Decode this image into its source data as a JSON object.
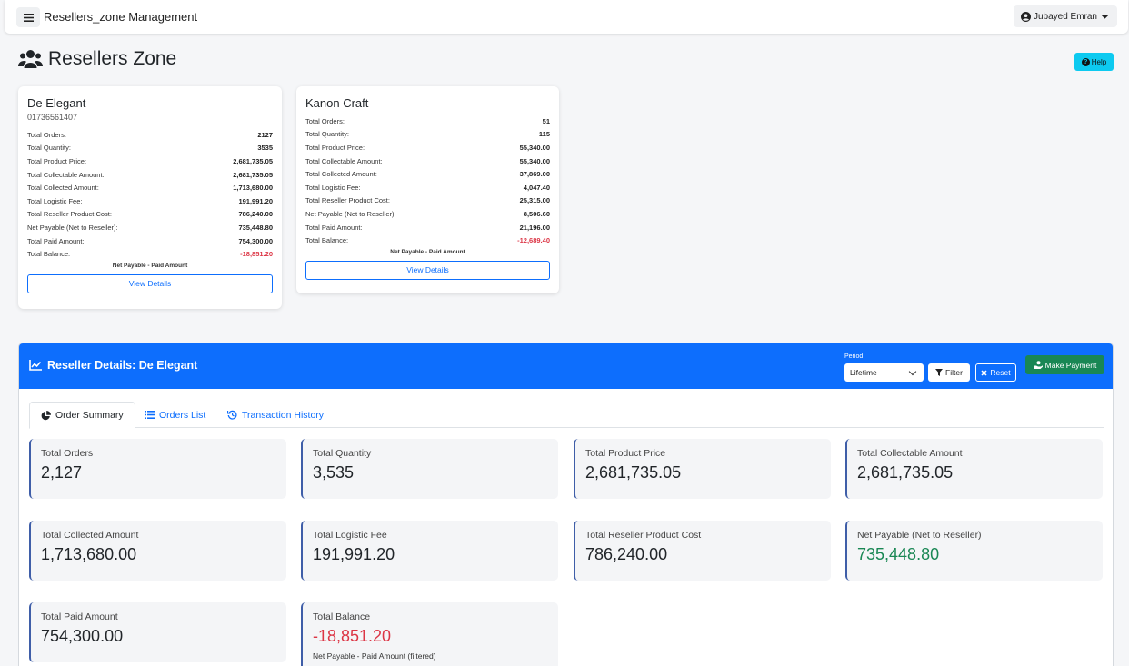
{
  "navbar": {
    "menu_icon": "hamburger-icon",
    "title": "Resellers_zone Management",
    "user_name": "Jubayed Emran"
  },
  "page": {
    "title": "Resellers Zone",
    "help_label": "Help"
  },
  "resellers": [
    {
      "name": "De Elegant",
      "phone": "01736561407",
      "rows": [
        {
          "label": "Total Orders:",
          "value": "2127"
        },
        {
          "label": "Total Quantity:",
          "value": "3535"
        },
        {
          "label": "Total Product Price:",
          "value": "2,681,735.05"
        },
        {
          "label": "Total Collectable Amount:",
          "value": "2,681,735.05"
        },
        {
          "label": "Total Collected Amount:",
          "value": "1,713,680.00"
        },
        {
          "label": "Total Logistic Fee:",
          "value": "191,991.20"
        },
        {
          "label": "Total Reseller Product Cost:",
          "value": "786,240.00"
        },
        {
          "label": "Net Payable (Net to Reseller):",
          "value": "735,448.80"
        },
        {
          "label": "Total Paid Amount:",
          "value": "754,300.00"
        },
        {
          "label": "Total Balance:",
          "value": "-18,851.20"
        }
      ],
      "note": "Net Payable - Paid Amount",
      "button_label": "View Details"
    },
    {
      "name": "Kanon Craft",
      "rows": [
        {
          "label": "Total Orders:",
          "value": "51"
        },
        {
          "label": "Total Quantity:",
          "value": "115"
        },
        {
          "label": "Total Product Price:",
          "value": "55,340.00"
        },
        {
          "label": "Total Collectable Amount:",
          "value": "55,340.00"
        },
        {
          "label": "Total Collected Amount:",
          "value": "37,869.00"
        },
        {
          "label": "Total Logistic Fee:",
          "value": "4,047.40"
        },
        {
          "label": "Total Reseller Product Cost:",
          "value": "25,315.00"
        },
        {
          "label": "Net Payable (Net to Reseller):",
          "value": "8,506.60"
        },
        {
          "label": "Total Paid Amount:",
          "value": "21,196.00"
        },
        {
          "label": "Total Balance:",
          "value": "-12,689.40"
        }
      ],
      "note": "Net Payable - Paid Amount",
      "button_label": "View Details"
    }
  ],
  "details": {
    "title": "Reseller Details: De Elegant",
    "period_label": "Period",
    "period_value": "Lifetime",
    "filter_label": "Filter",
    "reset_label": "Reset",
    "payment_label": "Make Payment",
    "tabs": [
      {
        "label": "Order Summary",
        "active": true
      },
      {
        "label": "Orders List",
        "active": false
      },
      {
        "label": "Transaction History",
        "active": false
      }
    ],
    "stats": [
      {
        "label": "Total Orders",
        "value": "2,127"
      },
      {
        "label": "Total Quantity",
        "value": "3,535"
      },
      {
        "label": "Total Product Price",
        "value": "2,681,735.05"
      },
      {
        "label": "Total Collectable Amount",
        "value": "2,681,735.05"
      },
      {
        "label": "Total Collected Amount",
        "value": "1,713,680.00"
      },
      {
        "label": "Total Logistic Fee",
        "value": "191,991.20"
      },
      {
        "label": "Total Reseller Product Cost",
        "value": "786,240.00"
      },
      {
        "label": "Net Payable (Net to Reseller)",
        "value": "735,448.80"
      },
      {
        "label": "Total Paid Amount",
        "value": "754,300.00"
      },
      {
        "label": "Total Balance",
        "value": "-18,851.20",
        "sub": "Net Payable - Paid Amount (filtered)"
      }
    ]
  },
  "colors": {
    "primary": "#0d6efd",
    "success": "#198754",
    "danger": "#dc3545",
    "info": "#0dcaf0",
    "card_accent": "#3f5ea8"
  }
}
